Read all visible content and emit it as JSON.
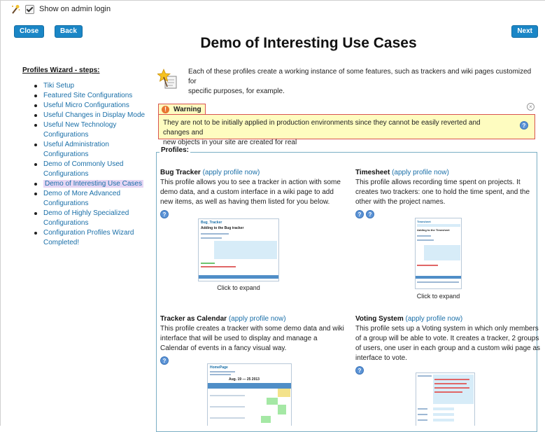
{
  "top": {
    "show_on_admin_login": "Show on admin login"
  },
  "nav": {
    "close_label": "Close",
    "back_label": "Back",
    "next_label": "Next"
  },
  "page_title": "Demo of Interesting Use Cases",
  "sidebar": {
    "heading": "Profiles Wizard - steps:",
    "items": [
      {
        "label": "Tiki Setup"
      },
      {
        "label": "Featured Site Configurations"
      },
      {
        "label": "Useful Micro Configurations"
      },
      {
        "label": "Useful Changes in Display Mode"
      },
      {
        "label": "Useful New Technology Configurations"
      },
      {
        "label": "Useful Administration Configurations"
      },
      {
        "label": "Demo of Commonly Used Configurations"
      },
      {
        "label": "Demo of Interesting Use Cases",
        "active": true
      },
      {
        "label": "Demo of More Advanced Configurations"
      },
      {
        "label": "Demo of Highly Specialized Configurations"
      },
      {
        "label": "Configuration Profiles Wizard Completed!"
      }
    ]
  },
  "intro": {
    "line1": "Each of these profiles create a working instance of some features, such as trackers and wiki pages customized for",
    "line2": "specific purposes, for example."
  },
  "warning": {
    "title": "Warning",
    "line1": "They are not to be initially applied in production environments since they cannot be easily reverted and changes and",
    "line2": "new objects in your site are created for real"
  },
  "profiles_legend": "Profiles:",
  "profiles": [
    {
      "name": "Bug Tracker",
      "apply": "(apply profile now)",
      "desc": [
        "This profile allows you to see a tracker in action with some",
        "demo data, and a custom interface in a wiki page to add",
        "new items, as well as having them listed for you below."
      ],
      "caption": "Click to expand",
      "thumb_title": "Bug_Tracker",
      "thumb_sub": "Adding to the Bug tracker"
    },
    {
      "name": "Timesheet",
      "apply": "(apply profile now)",
      "desc": [
        "This profile allows recording time spent on projects. It",
        "creates two trackers: one to hold the time spent, and the",
        "other with the project names."
      ],
      "caption": "Click to expand",
      "thumb_title": "Timesheet",
      "thumb_sub": "Adding to the Timesheet"
    },
    {
      "name": "Tracker as Calendar",
      "apply": "(apply profile now)",
      "desc": [
        "This profile creates a tracker with some demo data and wiki",
        "interface that will be used to display and manage a",
        "Calendar of events in a fancy visual way."
      ],
      "thumb_title": "HomePage",
      "thumb_sub": "Aug. 19 — 25 2013"
    },
    {
      "name": "Voting System",
      "apply": "(apply profile now)",
      "desc": [
        "This profile sets up a Voting system in which only members",
        "of a group will be able to vote. It creates a tracker, 2 groups",
        "of users, one user in each group and a custom wiki page as",
        "interface to vote."
      ]
    }
  ],
  "icons": {
    "wand": "wizard-wand-icon",
    "help": "help-icon",
    "close": "close-icon",
    "warning": "warning-icon"
  },
  "colors": {
    "button": "#1a86c6",
    "link": "#1a6fa8",
    "warning_bg": "#fefcc0",
    "warning_border": "#d9534f",
    "active_item_bg": "#e6d6f4"
  }
}
